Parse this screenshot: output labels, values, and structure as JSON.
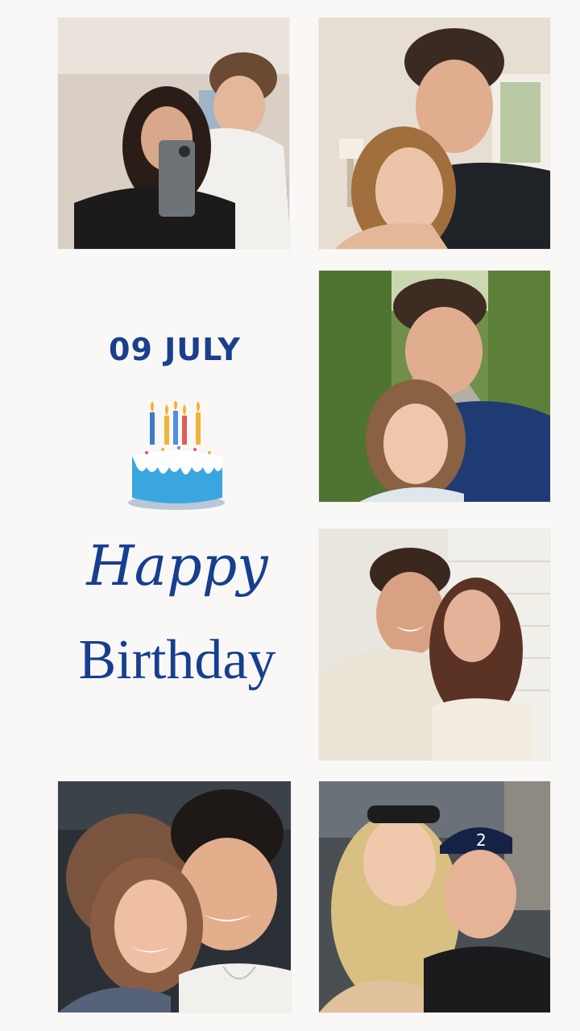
{
  "date_text": "09 JULY",
  "greeting": {
    "line1": "Happy",
    "line2": "Birthday"
  },
  "colors": {
    "accent": "#163f8f",
    "background": "#faf8f7",
    "cake_blue": "#3aa6e0"
  },
  "photos": [
    {
      "name": "couple-mirror-selfie-photo"
    },
    {
      "name": "couple-cuddle-photo"
    },
    {
      "name": "couple-garden-path-selfie-photo"
    },
    {
      "name": "couple-laughing-selfie-photo"
    },
    {
      "name": "couple-smiling-closeup-photo"
    },
    {
      "name": "couple-cap-selfie-photo"
    }
  ],
  "icons": {
    "cake": "birthday-cake-icon"
  }
}
